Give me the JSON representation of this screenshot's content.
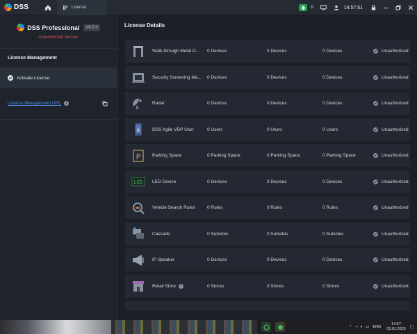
{
  "header": {
    "logo_text": "DSS",
    "tab_label": "License",
    "notification_count": "0",
    "clock": "14:57:51"
  },
  "sidebar": {
    "product_name": "DSS Professional",
    "version": "V8.5.0",
    "status": "Unauthorized Version",
    "section_title": "License Management",
    "activate_label": "Activate License",
    "url_label": "License Management URL"
  },
  "main": {
    "title": "License Details",
    "rows": [
      {
        "name": "Walk-through Metal D...",
        "c1": "0 Devices",
        "c2": "0 Devices",
        "c3": "0 Devices",
        "status": "Unauthorized",
        "icon": "metal-detector-icon"
      },
      {
        "name": "Security Screening Ma...",
        "c1": "0 Devices",
        "c2": "0 Devices",
        "c3": "0 Devices",
        "status": "Unauthorized",
        "icon": "xray-scanner-icon"
      },
      {
        "name": "Radar",
        "c1": "0 Devices",
        "c2": "0 Devices",
        "c3": "0 Devices",
        "status": "Unauthorized",
        "icon": "radar-icon"
      },
      {
        "name": "DSS Agile VDP User",
        "c1": "0 Users",
        "c2": "0 Users",
        "c3": "0 Users",
        "status": "Unauthorized",
        "icon": "mobile-app-icon"
      },
      {
        "name": "Parking Space",
        "c1": "0 Parking Space",
        "c2": "0 Parking Space",
        "c3": "0 Parking Space",
        "status": "Unauthorized",
        "icon": "parking-icon"
      },
      {
        "name": "LED Device",
        "c1": "0 Devices",
        "c2": "0 Devices",
        "c3": "0 Devices",
        "status": "Unauthorized",
        "icon": "led-icon"
      },
      {
        "name": "Vehicle Search Rules",
        "c1": "0 Rules",
        "c2": "0 Rules",
        "c3": "0 Rules",
        "status": "Unauthorized",
        "icon": "vehicle-search-icon"
      },
      {
        "name": "Cascade",
        "c1": "0 Subsites",
        "c2": "0 Subsites",
        "c3": "0 Subsites",
        "status": "Unauthorized",
        "icon": "cascade-icon"
      },
      {
        "name": "IP Speaker",
        "c1": "0 Devices",
        "c2": "0 Devices",
        "c3": "0 Devices",
        "status": "Unauthorized",
        "icon": "speaker-icon"
      },
      {
        "name": "Retail Store",
        "c1": "0 Stores",
        "c2": "0 Stores",
        "c3": "0 Stores",
        "status": "Unauthorized",
        "icon": "retail-store-icon"
      }
    ]
  },
  "taskbar": {
    "language": "ENG",
    "time": "14:57",
    "date": "03.01.2025"
  },
  "colors": {
    "accent_green": "#23a455",
    "unauthorized_red": "#e05252",
    "link_blue": "#4d8fe8"
  }
}
